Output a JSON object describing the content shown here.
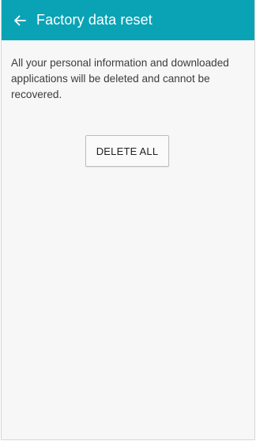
{
  "header": {
    "title": "Factory data reset",
    "back_icon": "arrow-left-icon",
    "color": "#0aa3b5"
  },
  "main": {
    "message": "All your personal information and downloaded applications will be deleted and cannot be recovered.",
    "delete_button_label": "DELETE ALL"
  }
}
